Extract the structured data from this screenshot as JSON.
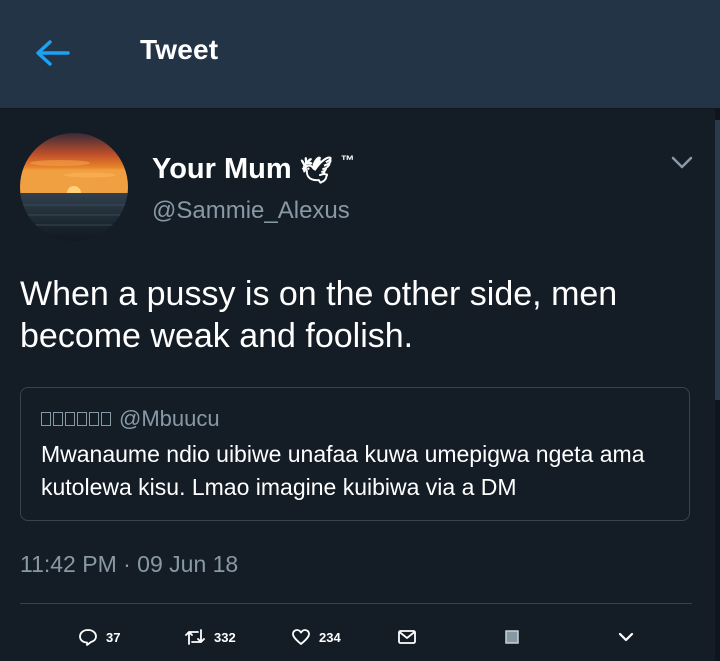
{
  "header": {
    "title": "Tweet"
  },
  "tweet": {
    "display_name": "Your Mum",
    "name_emoji": "🕊",
    "name_suffix": "™",
    "handle": "@Sammie_Alexus",
    "text": "When a pussy is on the other side, men become weak and foolish.",
    "timestamp": "11:42 PM · 09 Jun 18"
  },
  "quoted_tweet": {
    "handle": "@Mbuucu",
    "text": "Mwanaume ndio uibiwe unafaa kuwa umepigwa ngeta ama kutolewa kisu. Lmao imagine kuibiwa via a DM"
  },
  "actions": {
    "reply_count": "37",
    "retweet_count": "332",
    "like_count": "234"
  },
  "icons": {
    "back": "back-arrow-icon",
    "caret": "chevron-down-icon",
    "reply": "reply-icon",
    "retweet": "retweet-icon",
    "like": "heart-icon",
    "dm": "envelope-icon",
    "share": "share-icon",
    "more": "chevron-down-icon"
  },
  "colors": {
    "background": "#141d26",
    "header": "#243447",
    "accent": "#1da1f2",
    "muted_text": "#8899a6",
    "border": "#38444d"
  }
}
